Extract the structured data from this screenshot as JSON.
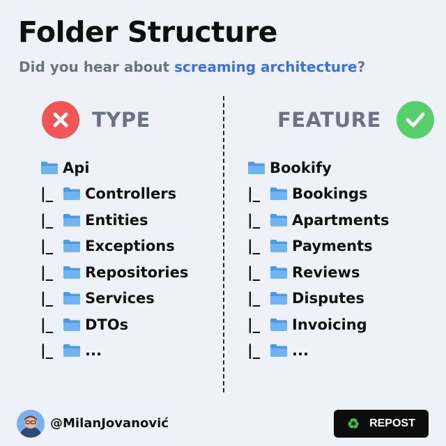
{
  "title": "Folder Structure",
  "subtitle": {
    "prefix": "Did you hear about ",
    "highlight": "screaming architecture",
    "suffix": "?"
  },
  "left": {
    "heading": "TYPE",
    "icon": "x-mark-icon",
    "root": "Api",
    "items": [
      "Controllers",
      "Entities",
      "Exceptions",
      "Repositories",
      "Services",
      "DTOs",
      "..."
    ]
  },
  "right": {
    "heading": "FEATURE",
    "icon": "check-mark-icon",
    "root": "Bookify",
    "items": [
      "Bookings",
      "Apartments",
      "Payments",
      "Reviews",
      "Disputes",
      "Invoicing",
      "..."
    ]
  },
  "tree_prefix": "|_",
  "footer": {
    "handle": "@MilanJovanović",
    "repost_label": "REPOST"
  },
  "colors": {
    "highlight": "#3b6fe8",
    "reject": "#f25555",
    "accept": "#55d06a",
    "folder": "#4a9be6"
  }
}
